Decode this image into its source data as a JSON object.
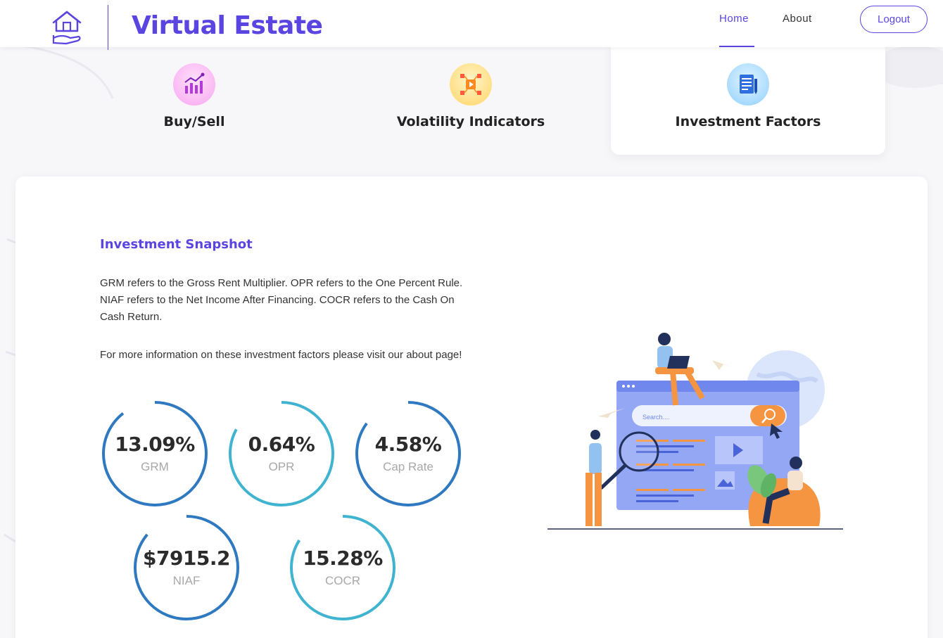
{
  "header": {
    "brand": "Virtual Estate",
    "nav": {
      "home": "Home",
      "about": "About"
    },
    "logout_label": "Logout"
  },
  "tabs": [
    {
      "label": "Buy/Sell",
      "icon": "chart-icon",
      "active": false
    },
    {
      "label": "Volatility Indicators",
      "icon": "network-icon",
      "active": false
    },
    {
      "label": "Investment Factors",
      "icon": "document-icon",
      "active": true
    }
  ],
  "snapshot": {
    "title": "Investment Snapshot",
    "paragraph1": "GRM refers to the Gross Rent Multiplier. OPR refers to the One Percent Rule. NIAF refers to the Net Income After Financing. COCR refers to the Cash On Cash Return.",
    "paragraph2": "For more information on these investment factors please visit our about page!"
  },
  "metrics": [
    {
      "value": "13.09%",
      "label": "GRM",
      "color": "#2f79c0"
    },
    {
      "value": "0.64%",
      "label": "OPR",
      "color": "#3fb3cf"
    },
    {
      "value": "4.58%",
      "label": "Cap Rate",
      "color": "#2f79c0"
    },
    {
      "value": "$7915.2",
      "label": "NIAF",
      "color": "#2f79c0"
    },
    {
      "value": "15.28%",
      "label": "COCR",
      "color": "#3fb3cf"
    }
  ],
  "illustration": {
    "search_placeholder": "Search...."
  },
  "colors": {
    "accent": "#5b45e0",
    "gauge_blue": "#2f79c0",
    "gauge_teal": "#3fb3cf"
  }
}
